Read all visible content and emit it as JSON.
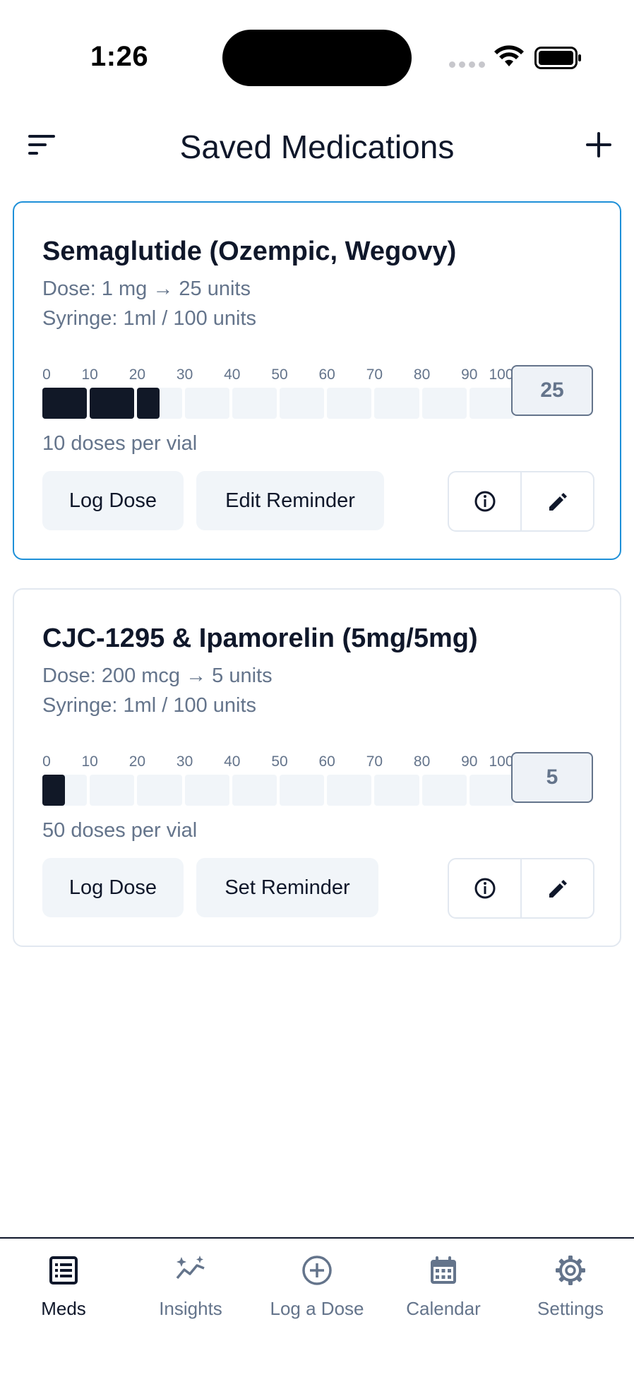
{
  "status_bar": {
    "time": "1:26"
  },
  "header": {
    "title": "Saved Medications",
    "menu_icon": "sort-lines-icon",
    "add_icon": "plus-icon"
  },
  "scale_ticks": [
    "0",
    "10",
    "20",
    "30",
    "40",
    "50",
    "60",
    "70",
    "80",
    "90",
    "100"
  ],
  "medications": [
    {
      "name": "Semaglutide (Ozempic, Wegovy)",
      "dose": "Dose: 1 mg → 25 units",
      "syringe": "Syringe: 1ml / 100 units",
      "units": "25",
      "units_fraction": 0.25,
      "doses_per_vial": "10 doses per vial",
      "primary_button": "Log Dose",
      "secondary_button": "Edit Reminder",
      "selected": true
    },
    {
      "name": "CJC-1295 & Ipamorelin (5mg/5mg)",
      "dose": "Dose: 200 mcg → 5 units",
      "syringe": "Syringe: 1ml / 100 units",
      "units": "5",
      "units_fraction": 0.05,
      "doses_per_vial": "50 doses per vial",
      "primary_button": "Log Dose",
      "secondary_button": "Set Reminder",
      "selected": false
    }
  ],
  "nav": [
    {
      "label": "Meds",
      "icon": "list-icon",
      "active": true
    },
    {
      "label": "Insights",
      "icon": "sparkle-chart-icon",
      "active": false
    },
    {
      "label": "Log a Dose",
      "icon": "plus-circle-icon",
      "active": false
    },
    {
      "label": "Calendar",
      "icon": "calendar-icon",
      "active": false
    },
    {
      "label": "Settings",
      "icon": "gear-icon",
      "active": false
    }
  ],
  "colors": {
    "accent_border": "#1e90d8",
    "fill": "#111827",
    "muted_text": "#64748b"
  }
}
